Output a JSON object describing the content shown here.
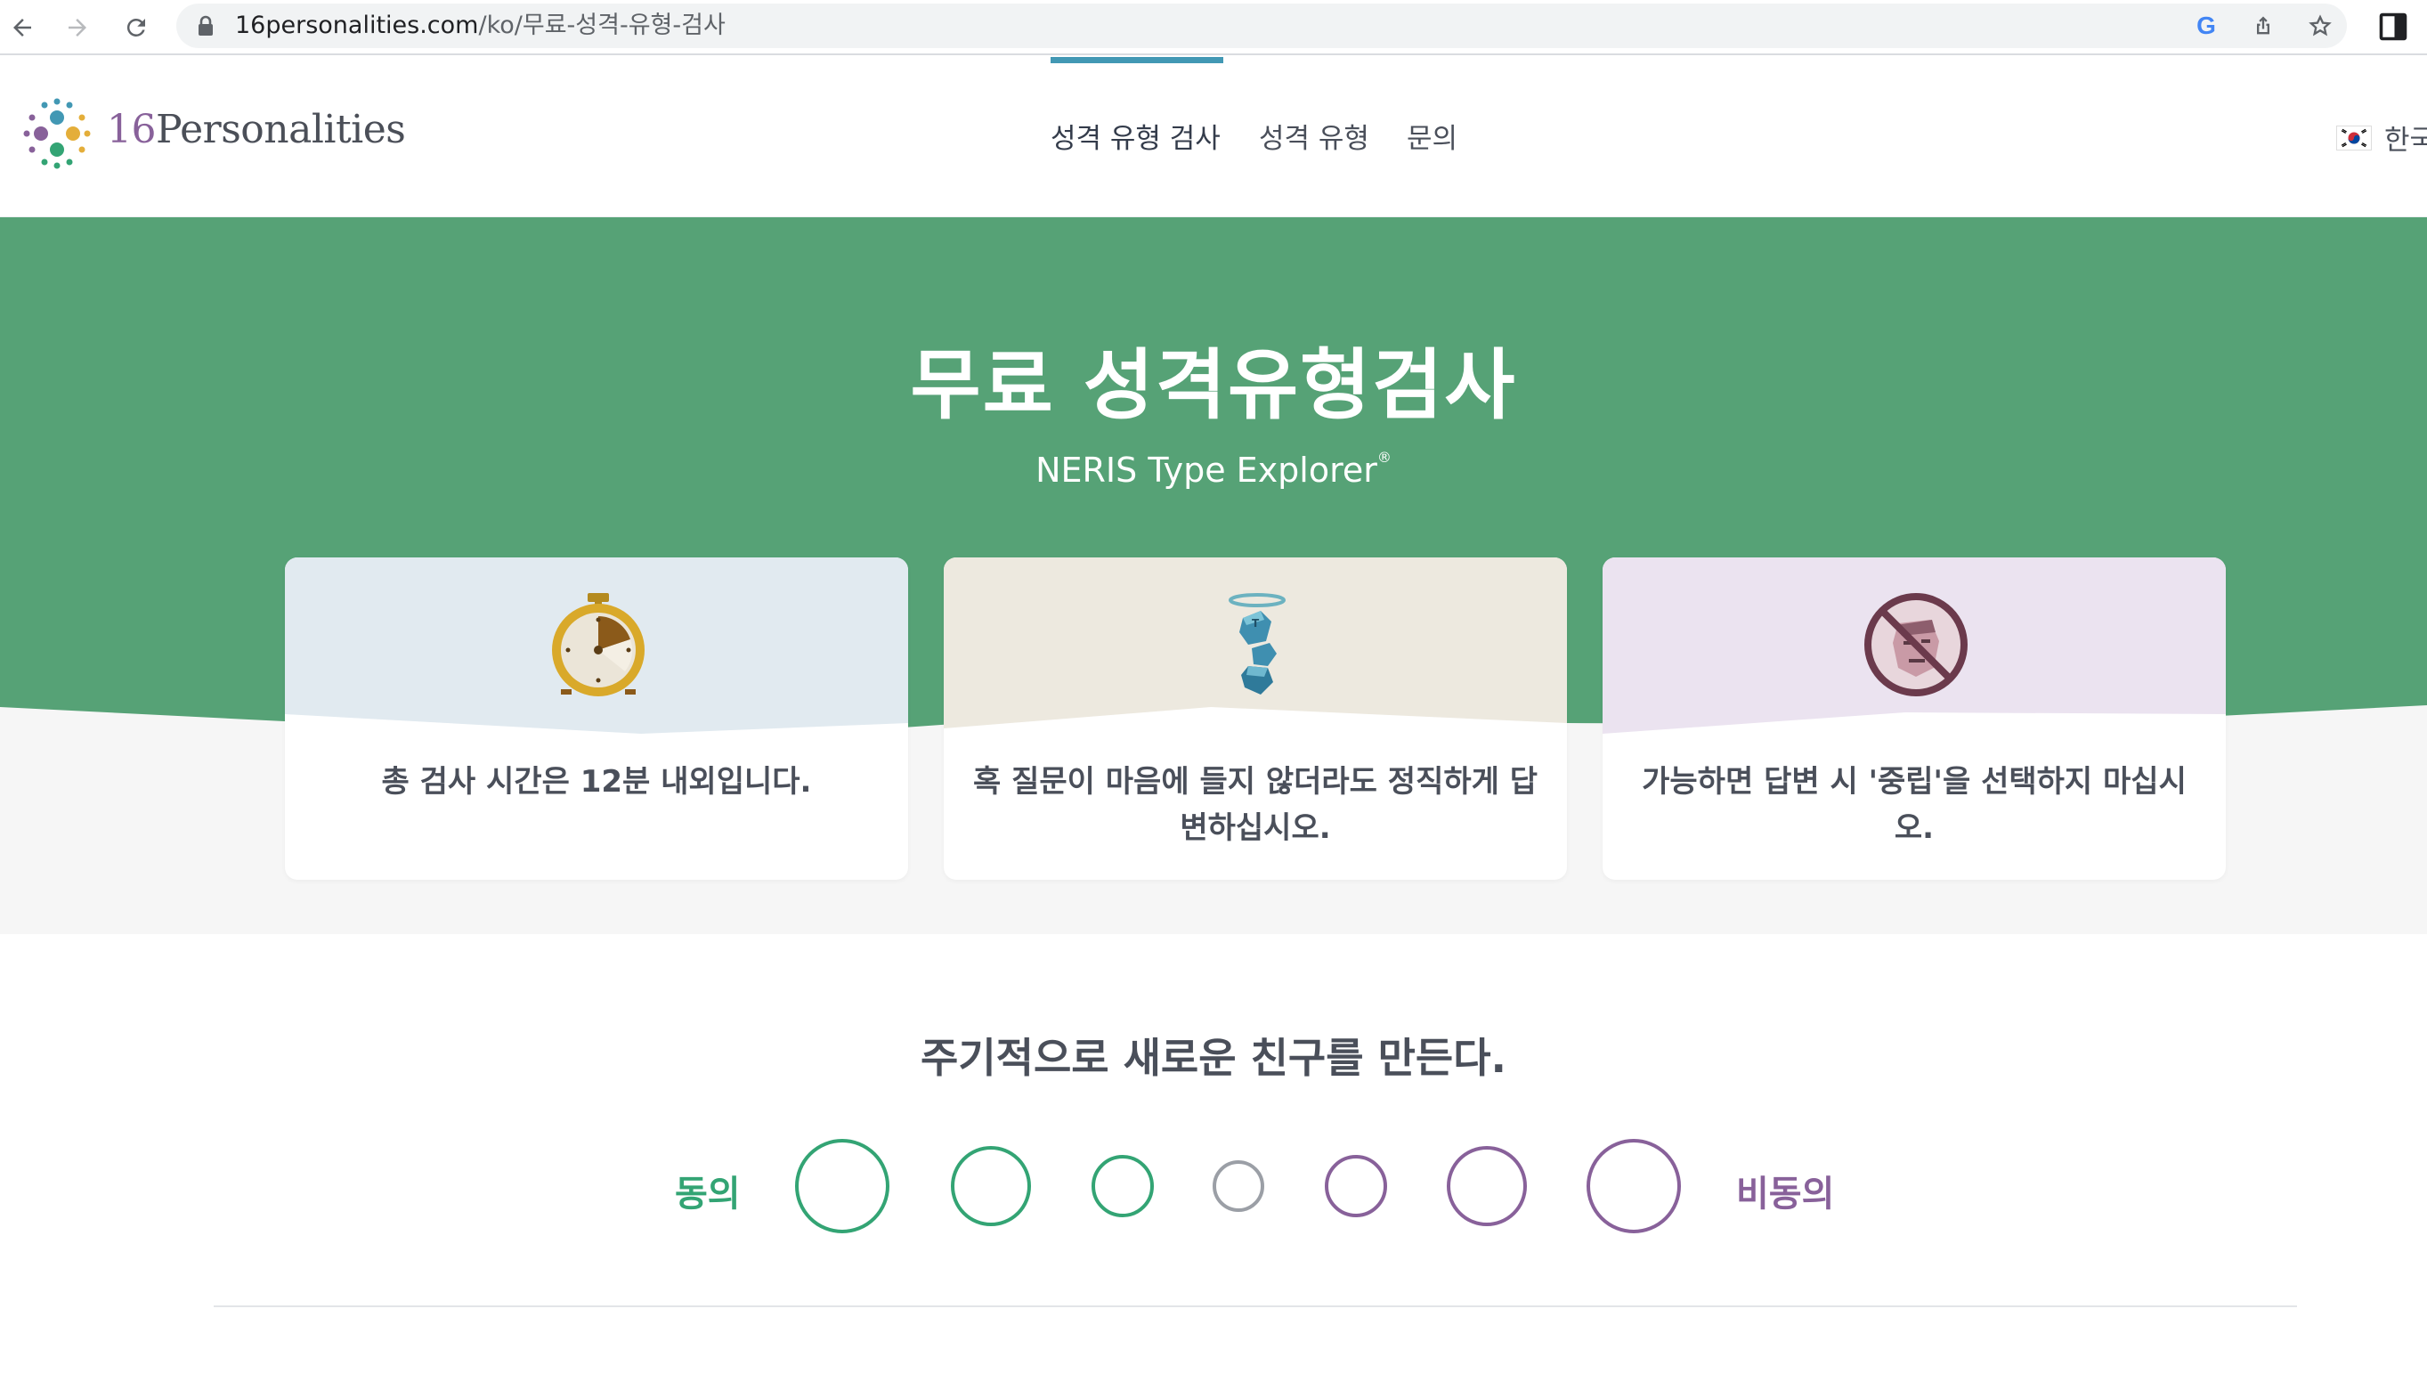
{
  "browser": {
    "url_host": "16personalities.com",
    "url_path": "/ko/무료-성격-유형-검사",
    "icons": [
      "back-icon",
      "forward-icon",
      "reload-icon",
      "lock-icon",
      "google-icon",
      "share-icon",
      "star-icon",
      "side-panel-icon"
    ]
  },
  "header": {
    "logo_number": "16",
    "logo_word": "Personalities",
    "nav": [
      {
        "label": "성격 유형 검사",
        "active": true
      },
      {
        "label": "성격 유형",
        "active": false
      },
      {
        "label": "문의",
        "active": false
      }
    ],
    "language_label": "한국"
  },
  "hero": {
    "title": "무료 성격유형검사",
    "subtitle": "NERIS Type Explorer",
    "subtitle_mark": "®",
    "cards": [
      {
        "icon": "stopwatch-icon",
        "text": "총 검사 시간은 12분 내외입니다."
      },
      {
        "icon": "angel-figure-icon",
        "text": "혹 질문이 마음에 들지 않더라도 정직하게 답변하십시오."
      },
      {
        "icon": "no-neutral-face-icon",
        "text": "가능하면 답변 시 '중립'을 선택하지 마십시오."
      }
    ]
  },
  "question": {
    "text": "주기적으로 새로운 친구를 만든다.",
    "agree_label": "동의",
    "disagree_label": "비동의",
    "options_count": 7
  },
  "colors": {
    "hero_green": "#56a276",
    "agree_green": "#33a474",
    "disagree_purple": "#88619a",
    "neutral_gray": "#9b9fa6",
    "active_tab": "#4298b4",
    "card1_top": "#e1eaf0",
    "card2_top": "#ede9df",
    "card3_top": "#ebe3f0"
  }
}
